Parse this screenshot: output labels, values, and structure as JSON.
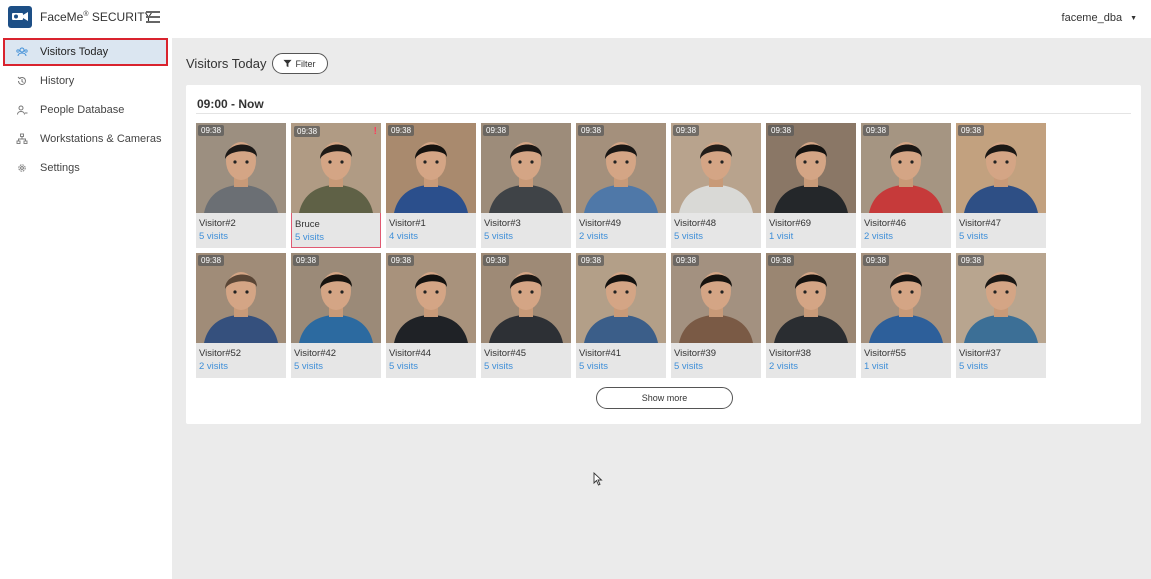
{
  "header": {
    "brand": "FaceMe",
    "brand_reg": "®",
    "brand_suffix": " SECURITY",
    "user": "faceme_dba"
  },
  "sidebar": {
    "items": [
      {
        "label": "Visitors Today",
        "icon": "visitors-icon",
        "active": true
      },
      {
        "label": "History",
        "icon": "history-icon"
      },
      {
        "label": "People Database",
        "icon": "people-icon"
      },
      {
        "label": "Workstations & Cameras",
        "icon": "network-icon"
      },
      {
        "label": "Settings",
        "icon": "gear-icon"
      }
    ]
  },
  "main": {
    "title": "Visitors Today",
    "filter_label": "Filter",
    "section_title": "09:00 - Now",
    "show_more": "Show more"
  },
  "visitors": [
    {
      "time": "09:38",
      "name": "Visitor#2",
      "visits": "5 visits",
      "bg": "#9c8f80",
      "shirt": "#6b6f74",
      "hair": "#1d1a18"
    },
    {
      "time": "09:38",
      "name": "Bruce",
      "visits": "5 visits",
      "bg": "#b09b84",
      "shirt": "#5f6146",
      "hair": "#1e1a16",
      "flagged": true
    },
    {
      "time": "09:38",
      "name": "Visitor#1",
      "visits": "4 visits",
      "bg": "#a98a6e",
      "shirt": "#2b4f8c",
      "hair": "#15120f"
    },
    {
      "time": "09:38",
      "name": "Visitor#3",
      "visits": "5 visits",
      "bg": "#9d8c7a",
      "shirt": "#3f4347",
      "hair": "#1a1715"
    },
    {
      "time": "09:38",
      "name": "Visitor#49",
      "visits": "2 visits",
      "bg": "#a4907c",
      "shirt": "#4f78a8",
      "hair": "#1a1715"
    },
    {
      "time": "09:38",
      "name": "Visitor#48",
      "visits": "5 visits",
      "bg": "#b8a38d",
      "shirt": "#d9d9d6",
      "hair": "#221d19"
    },
    {
      "time": "09:38",
      "name": "Visitor#69",
      "visits": "1 visit",
      "bg": "#8a7766",
      "shirt": "#24272a",
      "hair": "#141210"
    },
    {
      "time": "09:38",
      "name": "Visitor#46",
      "visits": "2 visits",
      "bg": "#a59582",
      "shirt": "#c63a3a",
      "hair": "#1a1715"
    },
    {
      "time": "09:38",
      "name": "Visitor#47",
      "visits": "5 visits",
      "bg": "#c2a17f",
      "shirt": "#2e4f85",
      "hair": "#1b1815"
    },
    {
      "time": "09:38",
      "name": "Visitor#52",
      "visits": "2 visits",
      "bg": "#a08c78",
      "shirt": "#35507d",
      "hair": "#5a4636"
    },
    {
      "time": "09:38",
      "name": "Visitor#42",
      "visits": "5 visits",
      "bg": "#9b8a78",
      "shirt": "#2c6aa0",
      "hair": "#17130f"
    },
    {
      "time": "09:38",
      "name": "Visitor#44",
      "visits": "5 visits",
      "bg": "#a8927c",
      "shirt": "#1f2226",
      "hair": "#141210"
    },
    {
      "time": "09:38",
      "name": "Visitor#45",
      "visits": "5 visits",
      "bg": "#9e8a76",
      "shirt": "#2d3035",
      "hair": "#1b1815"
    },
    {
      "time": "09:38",
      "name": "Visitor#41",
      "visits": "5 visits",
      "bg": "#b39f88",
      "shirt": "#3b5e89",
      "hair": "#141210"
    },
    {
      "time": "09:38",
      "name": "Visitor#39",
      "visits": "5 visits",
      "bg": "#a39180",
      "shirt": "#7a5a45",
      "hair": "#17130f"
    },
    {
      "time": "09:38",
      "name": "Visitor#38",
      "visits": "2 visits",
      "bg": "#9a8672",
      "shirt": "#2a2d31",
      "hair": "#161310"
    },
    {
      "time": "09:38",
      "name": "Visitor#55",
      "visits": "1 visit",
      "bg": "#a5917e",
      "shirt": "#2d5f9a",
      "hair": "#151210"
    },
    {
      "time": "09:38",
      "name": "Visitor#37",
      "visits": "5 visits",
      "bg": "#b8a58f",
      "shirt": "#3c6f96",
      "hair": "#1b1815"
    }
  ]
}
